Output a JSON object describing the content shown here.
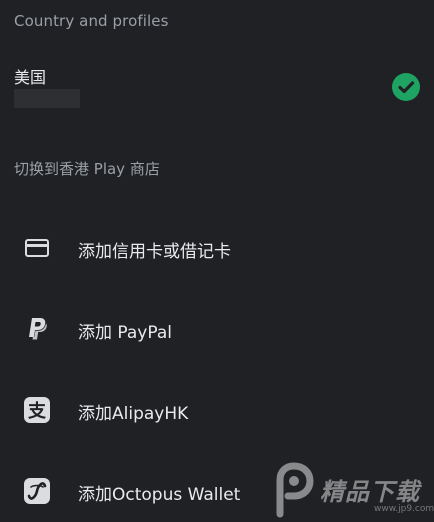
{
  "header": {
    "title": "Country and profiles"
  },
  "country": {
    "name": "美国",
    "selected_icon": "check-circle-icon",
    "accent_color": "#1ea362"
  },
  "switch_store": {
    "label": "切换到香港 Play 商店"
  },
  "payment_methods": [
    {
      "label": "添加信用卡或借记卡",
      "icon": "credit-card-icon"
    },
    {
      "label": "添加 PayPal",
      "icon": "paypal-icon"
    },
    {
      "label": "添加AlipayHK",
      "icon": "alipay-icon"
    },
    {
      "label": "添加Octopus Wallet",
      "icon": "octopus-icon"
    }
  ],
  "watermark": {
    "brand": "精品下载",
    "url": "www.jp9.com"
  }
}
